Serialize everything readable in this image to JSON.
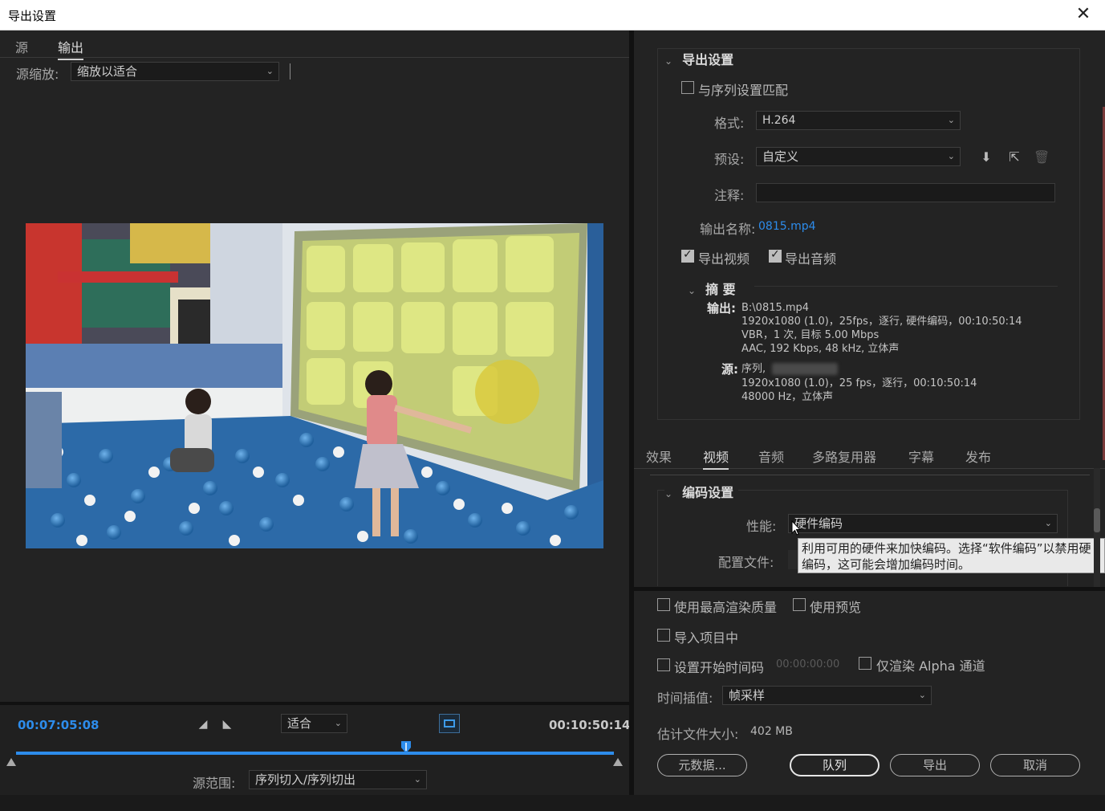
{
  "window": {
    "title": "导出设置",
    "close_glyph": "✕"
  },
  "left": {
    "tabs": [
      {
        "label": "源"
      },
      {
        "label": "输出"
      }
    ],
    "source_scale_label": "源缩放:",
    "source_scale_value": "缩放以适合",
    "timecode_current": "00:07:05:08",
    "timecode_end": "00:10:50:14",
    "fit_value": "适合",
    "source_range_label": "源范围:",
    "source_range_value": "序列切入/序列切出",
    "playhead_fraction": 0.653
  },
  "export": {
    "section_title": "导出设置",
    "match_sequence": "与序列设置匹配",
    "format_label": "格式:",
    "format_value": "H.264",
    "preset_label": "预设:",
    "preset_value": "自定义",
    "comment_label": "注释:",
    "output_name_label": "输出名称:",
    "output_name_value": "0815.mp4",
    "export_video": "导出视频",
    "export_audio": "导出音频",
    "summary_title": "摘 要",
    "summary_output_key": "输出:",
    "summary_output_lines": [
      "B:\\0815.mp4",
      "1920x1080 (1.0)，25fps，逐行, 硬件编码，00:10:50:14",
      "VBR，1 次, 目标 5.00 Mbps",
      "AAC, 192 Kbps, 48  kHz, 立体声"
    ],
    "summary_source_key": "源:",
    "summary_source_lines": [
      "序列,",
      "1920x1080 (1.0)，25 fps，逐行，00:10:50:14",
      "48000 Hz，立体声"
    ]
  },
  "right_tabs": [
    {
      "label": "效果"
    },
    {
      "label": "视频"
    },
    {
      "label": "音频"
    },
    {
      "label": "多路复用器"
    },
    {
      "label": "字幕"
    },
    {
      "label": "发布"
    }
  ],
  "encoding": {
    "section_title": "编码设置",
    "performance_label": "性能:",
    "performance_value": "硬件编码",
    "profile_label": "配置文件:",
    "tooltip_line1": "利用可用的硬件来加快编码。选择“软件编码”以禁用硬",
    "tooltip_line2": "编码，这可能会增加编码时间。"
  },
  "options": {
    "max_render_quality": "使用最高渲染质量",
    "use_previews": "使用预览",
    "import_into_project": "导入项目中",
    "set_start_timecode": "设置开始时间码",
    "start_timecode_value": "00:00:00:00",
    "render_alpha_only": "仅渲染 Alpha 通道",
    "time_interp_label": "时间插值:",
    "time_interp_value": "帧采样",
    "est_size_label": "估计文件大小:",
    "est_size_value": "402 MB"
  },
  "buttons": {
    "metadata": "元数据...",
    "queue": "队列",
    "export": "导出",
    "cancel": "取消"
  }
}
